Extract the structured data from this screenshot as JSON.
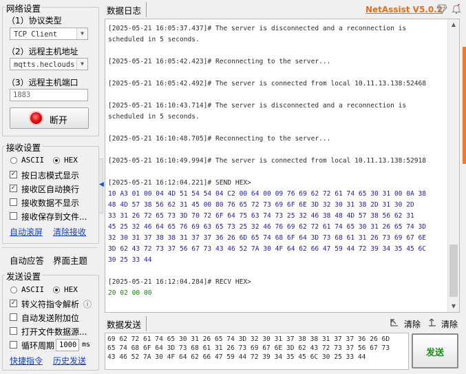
{
  "network_settings": {
    "title": "网络设置",
    "protocol_label": "（1）协议类型",
    "protocol_value": "TCP Client",
    "host_label": "（2）远程主机地址",
    "host_value": "mqtts.heclouds.c",
    "port_label": "（3）远程主机端口",
    "port_value": "1883",
    "disconnect_button": "断开",
    "indicator_color": "#e01010"
  },
  "receive_settings": {
    "title": "接收设置",
    "ascii_label": "ASCII",
    "hex_label": "HEX",
    "selected": "HEX",
    "options": [
      {
        "label": "按日志模式显示",
        "checked": true
      },
      {
        "label": "接收区自动换行",
        "checked": true
      },
      {
        "label": "接收数据不显示",
        "checked": false
      },
      {
        "label": "接收保存到文件...",
        "checked": false
      }
    ],
    "auto_scroll_link": "自动滚屏",
    "clear_receive_link": "清除接收"
  },
  "side_tabs": {
    "auto_reply": "自动应答",
    "ui_theme": "界面主题"
  },
  "send_settings": {
    "title": "发送设置",
    "ascii_label": "ASCII",
    "hex_label": "HEX",
    "selected": "HEX",
    "escape_label": "转义符指令解析",
    "escape_checked": true,
    "info_icon": "ⓘ",
    "auto_append_label": "自动发送附加位",
    "auto_append_checked": false,
    "file_source_label": "打开文件数据源...",
    "file_source_checked": false,
    "cycle_label": "循环周期",
    "cycle_checked": false,
    "cycle_value": "1000",
    "cycle_unit": "ms",
    "shortcut_link": "快捷指令",
    "history_link": "历史发送"
  },
  "log_panel": {
    "title": "数据日志",
    "app_name": "NetAssist V5.0.2",
    "lines": [
      {
        "text": "[2025-05-21 16:05:37.437]# The server is disconnected and a reconnection is",
        "kind": "sys"
      },
      {
        "text": "scheduled in 5 seconds.",
        "kind": "sys"
      },
      {
        "text": "[2025-05-21 16:05:42.423]# Reconnecting to the server...",
        "kind": "sys"
      },
      {
        "text": "[2025-05-21 16:05:42.492]# The server is connected from local 10.11.13.138:52468",
        "kind": "sys"
      },
      {
        "text": "[2025-05-21 16:10:43.714]# The server is disconnected and a reconnection is",
        "kind": "sys"
      },
      {
        "text": "scheduled in 5 seconds.",
        "kind": "sys"
      },
      {
        "text": "[2025-05-21 16:10:48.705]# Reconnecting to the server...",
        "kind": "sys"
      },
      {
        "text": "[2025-05-21 16:10:49.994]# The server is connected from local 10.11.13.138:52918",
        "kind": "sys"
      },
      {
        "text": "[2025-05-21 16:12:04.221]# SEND HEX>",
        "kind": "sys"
      },
      {
        "text": "10 A3 01 00 04 4D 51 54 54 04 C2 00 64 00 09 76 69 62 72 61 74 65 30 31 00 0A 38",
        "kind": "hex"
      },
      {
        "text": "48 4D 57 38 56 62 31 45 00 80 76 65 72 73 69 6F 6E 3D 32 30 31 38 2D 31 30 2D",
        "kind": "hex"
      },
      {
        "text": "33 31 26 72 65 73 3D 70 72 6F 64 75 63 74 73 25 32 46 38 48 4D 57 38 56 62 31",
        "kind": "hex"
      },
      {
        "text": "45 25 32 46 64 65 76 69 63 65 73 25 32 46 76 69 62 72 61 74 65 30 31 26 65 74 3D",
        "kind": "hex"
      },
      {
        "text": "32 30 31 37 38 38 31 37 37 36 26 6D 65 74 68 6F 64 3D 73 68 61 31 26 73 69 67 6E",
        "kind": "hex"
      },
      {
        "text": "3D 62 43 72 73 37 56 67 73 43 46 52 7A 30 4F 64 62 66 47 59 44 72 39 34 35 45 6C",
        "kind": "hex"
      },
      {
        "text": "30 25 33 44",
        "kind": "hex"
      },
      {
        "text": "[2025-05-21 16:12:04.284]# RECV HEX>",
        "kind": "sys"
      },
      {
        "text": "20 02 00 00",
        "kind": "recv"
      }
    ]
  },
  "send_panel": {
    "title": "数据发送",
    "clear_label_1": "清除",
    "clear_label_2": "清除",
    "send_button": "发送",
    "content": [
      "69 62 72 61 74 65 30 31 26 65 74 3D 32 30 31 37 38 38 31 37 37 36 26 6D",
      "65 74 68 6F 64 3D 73 68 61 31 26 73 69 67 6E 3D 62 43 72 73 37 56 67 73",
      "43 46 52 7A 30 4F 64 62 66 47 59 44 72 39 34 35 45 6C 30 25 33 44"
    ]
  }
}
